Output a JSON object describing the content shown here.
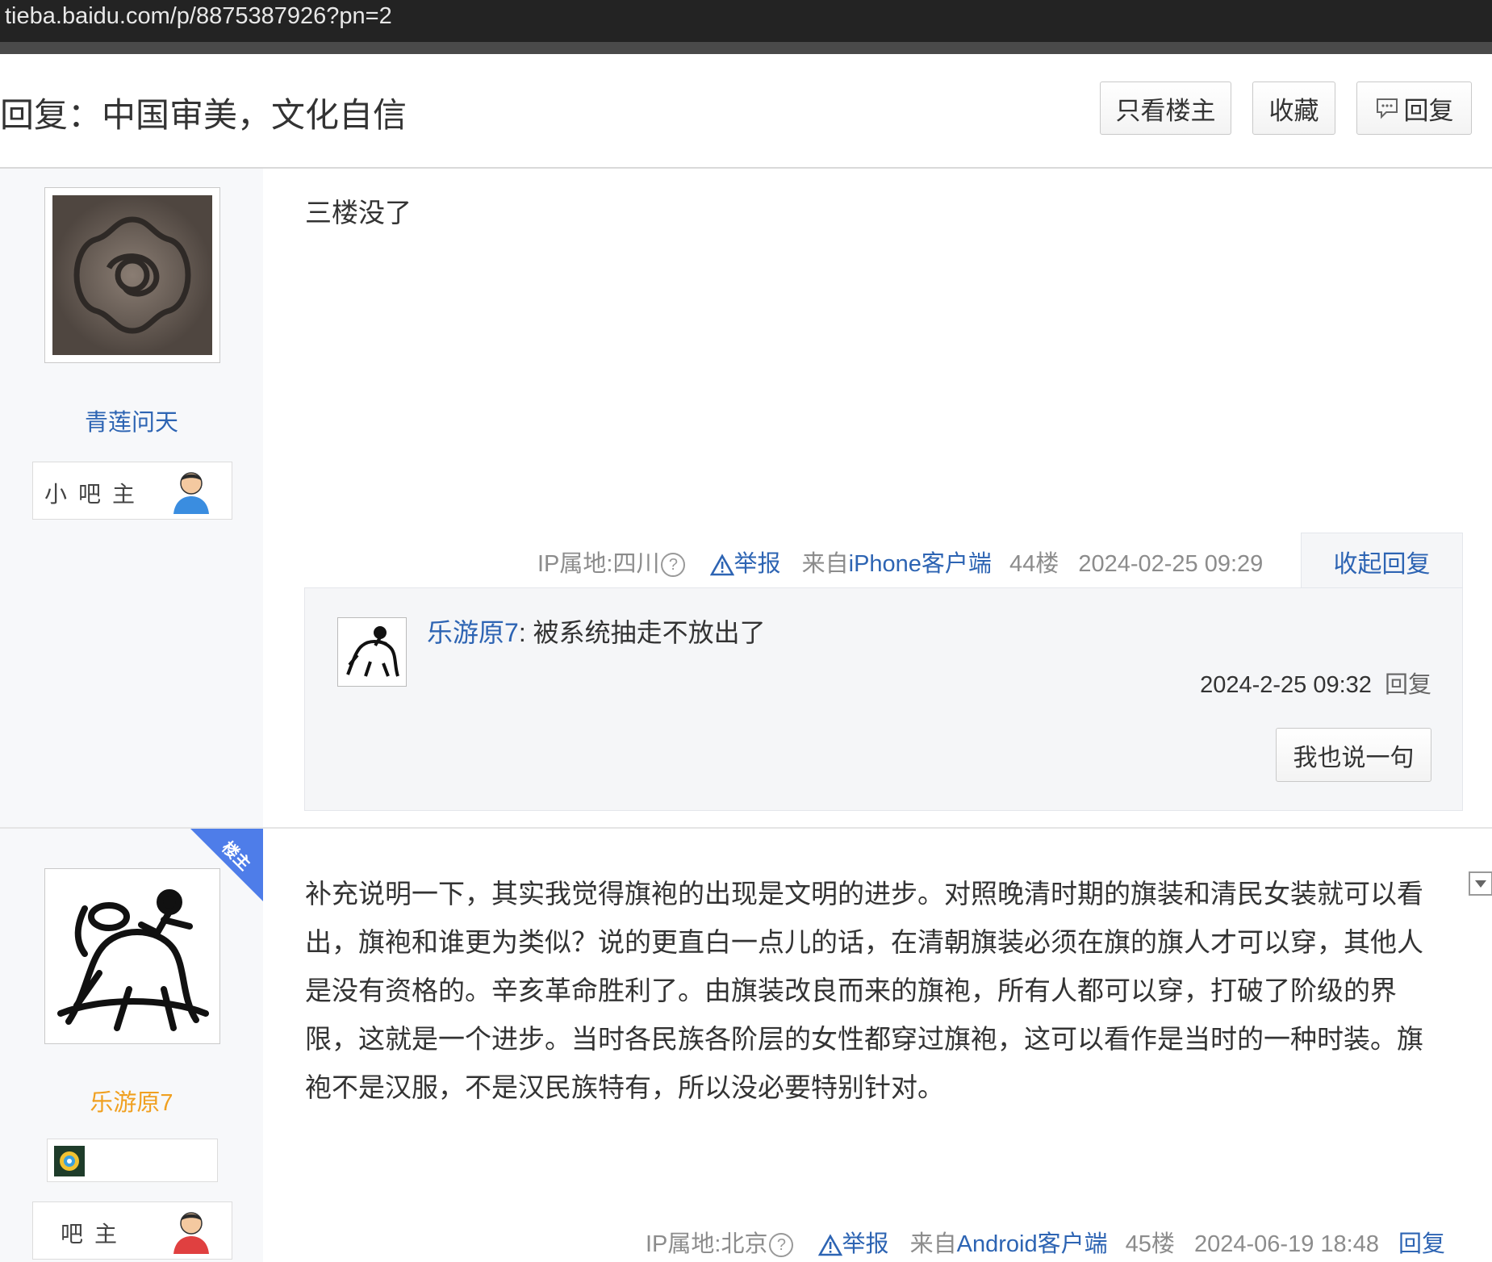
{
  "browser": {
    "url": "tieba.baidu.com/p/8875387926?pn=2"
  },
  "header": {
    "title": "回复：中国审美，文化自信",
    "only_op_label": "只看楼主",
    "favorite_label": "收藏",
    "reply_label": "回复"
  },
  "posts": [
    {
      "username": "青莲问天",
      "badge": "小吧主",
      "content": "三楼没了",
      "ip": "IP属地:四川",
      "report_label": "举报",
      "source_prefix": "来自",
      "source_client": "iPhone客户端",
      "floor": "44楼",
      "time": "2024-02-25 09:29",
      "collapse_label": "收起回复",
      "replies": [
        {
          "username": "乐游原7",
          "text": ": 被系统抽走不放出了",
          "time": "2024-2-25 09:32",
          "reply_label": "回复"
        }
      ],
      "say_button": "我也说一句"
    },
    {
      "username": "乐游原7",
      "badge": "吧主",
      "corner_tag": "楼主",
      "content": "补充说明一下，其实我觉得旗袍的出现是文明的进步。对照晚清时期的旗装和清民女装就可以看出，旗袍和谁更为类似？说的更直白一点儿的话，在清朝旗装必须在旗的旗人才可以穿，其他人是没有资格的。辛亥革命胜利了。由旗装改良而来的旗袍，所有人都可以穿，打破了阶级的界限，这就是一个进步。当时各民族各阶层的女性都穿过旗袍，这可以看作是当时的一种时装。旗袍不是汉服，不是汉民族特有，所以没必要特别针对。",
      "ip": "IP属地:北京",
      "report_label": "举报",
      "source_prefix": "来自",
      "source_client": "Android客户端",
      "floor": "45楼",
      "time": "2024-06-19 18:48",
      "reply_label": "回复"
    }
  ],
  "colors": {
    "link_blue": "#2d64b3",
    "op_orange": "#f0a020",
    "meta_gray": "#8c8c8c",
    "corner_blue": "#4e7de9"
  },
  "icons": [
    "question-icon",
    "warning-icon",
    "comment-icon",
    "user-avatar-icon",
    "dropdown-icon",
    "level-icon"
  ]
}
